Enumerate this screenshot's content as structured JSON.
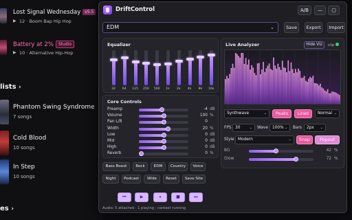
{
  "background_app": {
    "songs": [
      {
        "title": "Lost Signal Wednesday",
        "tag": "v5.5",
        "meta": "12 · Boom Bap Hip Hop"
      },
      {
        "title": "Battery at 2%",
        "tag": "Studio",
        "meta": "10 · Alternative Hip-Hop"
      }
    ],
    "playlists_header": "lists",
    "playlists": [
      {
        "name": "Phantom Swing Syndrome",
        "count": "7 songs"
      },
      {
        "name": "Cold Blood",
        "count": "10 songs"
      },
      {
        "name": "In Step",
        "count": "10 songs"
      }
    ],
    "bottom_header": "es"
  },
  "window": {
    "title": "DriftControl",
    "ab_label": "A/B",
    "minimize_glyph": "—",
    "maximize_glyph": "▢",
    "close_glyph": "✕"
  },
  "preset": {
    "selected": "EDM",
    "save_label": "Save",
    "export_label": "Export",
    "import_label": "Import"
  },
  "equalizer": {
    "title": "Equalizer",
    "bands": [
      {
        "label": "32",
        "level": 0.72
      },
      {
        "label": "64",
        "level": 0.78
      },
      {
        "label": "125",
        "level": 0.66
      },
      {
        "label": "250",
        "level": 0.62
      },
      {
        "label": "500",
        "level": 0.58
      },
      {
        "label": "1k",
        "level": 0.6
      },
      {
        "label": "2k",
        "level": 0.68
      },
      {
        "label": "4k",
        "level": 0.74
      },
      {
        "label": "8k",
        "level": 0.8
      },
      {
        "label": "16k",
        "level": 0.86
      }
    ]
  },
  "core_controls": {
    "title": "Core Controls",
    "rows": [
      {
        "label": "Preamp",
        "value": "-4",
        "unit": "dB",
        "level": 0.46
      },
      {
        "label": "Volume",
        "value": "100",
        "unit": "%",
        "level": 0.5
      },
      {
        "label": "Pan L/R",
        "value": "0",
        "unit": "",
        "level": 0.5
      },
      {
        "label": "Width",
        "value": "20",
        "unit": "%",
        "level": 0.58
      },
      {
        "label": "Low",
        "value": "0",
        "unit": "dB",
        "level": 0.5
      },
      {
        "label": "Mid",
        "value": "0",
        "unit": "dB",
        "level": 0.5
      },
      {
        "label": "High",
        "value": "0",
        "unit": "dB",
        "level": 0.5
      },
      {
        "label": "Reverb",
        "value": "0",
        "unit": "%",
        "level": 0.0
      }
    ]
  },
  "presets_row1": [
    "Bass Boost",
    "Rock",
    "EDM",
    "Country",
    "Voice"
  ],
  "presets_row2": [
    "Night",
    "Podcast",
    "Wide",
    "Reset",
    "Save Site"
  ],
  "transport": {
    "prev": "⏮",
    "play": "▶",
    "pause": "⏸",
    "stop": "■",
    "next": "⏭"
  },
  "status": "Audio: 5 attached · 1 playing · context running",
  "analyzer": {
    "title": "Live Analyzer",
    "hide_viz_label": "Hide Viz",
    "clip_label": "clip",
    "theme": "Synthwave",
    "peaks_label": "Peaks",
    "lines_label": "Lines",
    "speed": "Normal",
    "fps_label": "FPS",
    "fps": "30",
    "wave_label": "Wave",
    "wave": "100%",
    "bars_label": "Bars",
    "bars": "2px",
    "style_label": "Style",
    "style": "Modern",
    "snap_label": "Snap",
    "popout_label": "Popout",
    "bg_label": "BG",
    "bg_value": "42",
    "bg_unit": "%",
    "bg_level": 0.42,
    "glow_label": "Glow",
    "glow_value": "72",
    "glow_unit": "%",
    "glow_level": 0.72
  },
  "colors": {
    "accent": "#b48cff",
    "accent_pink": "#e85aa0",
    "accent_light": "#d8b8ff",
    "panel": "#24242a",
    "window": "#1e1e23"
  }
}
